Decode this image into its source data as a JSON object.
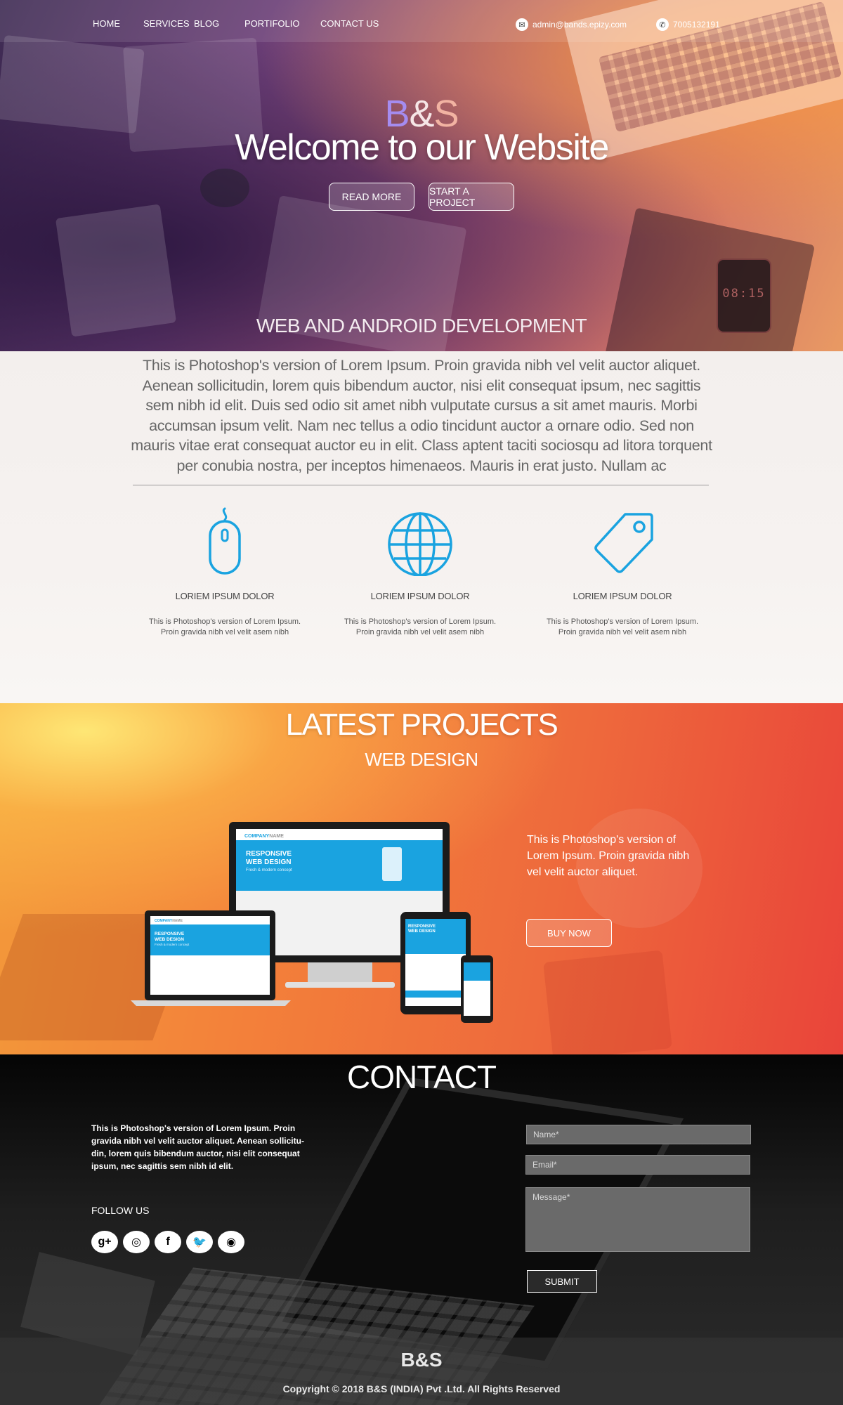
{
  "nav": {
    "items": [
      {
        "label": "HOME"
      },
      {
        "label": "SERVICES"
      },
      {
        "label": "BLOG"
      },
      {
        "label": "PORTIFOLIO"
      },
      {
        "label": "CONTACT US"
      }
    ],
    "email": "admin@bands.epizy.com",
    "phone": "7005132191",
    "email_icon": "envelope-icon",
    "phone_icon": "phone-icon"
  },
  "hero": {
    "logo": {
      "b": "B",
      "amp": "&",
      "s": "S"
    },
    "title": "Welcome to our Website",
    "read_more": "READ MORE",
    "start_project": "START A PROJECT",
    "subtitle": "WEB AND ANDROID DEVELOPMENT",
    "phone_time": "08:15"
  },
  "about": {
    "text": "This is Photoshop's version  of Lorem Ipsum. Proin gravida nibh vel velit auctor aliquet. Aenean sollicitudin, lorem quis bibendum auctor, nisi elit consequat ipsum, nec sagittis sem nibh id elit. Duis sed odio sit amet nibh vulputate cursus a sit amet mauris. Morbi accumsan ipsum velit. Nam nec tellus a odio tincidunt auctor a ornare odio. Sed non mauris vitae erat consequat auctor eu in elit. Class aptent taciti sociosqu ad litora torquent per conubia nostra, per inceptos himenaeos. Mauris in erat justo. Nullam ac"
  },
  "features": [
    {
      "icon": "mouse-icon",
      "title": "LORIEM IPSUM DOLOR",
      "desc": "This is Photoshop's version  of Lorem Ipsum. Proin gravida nibh vel velit asem nibh"
    },
    {
      "icon": "globe-icon",
      "title": "LORIEM IPSUM DOLOR",
      "desc": "This is Photoshop's version  of Lorem Ipsum. Proin gravida nibh vel velit asem nibh"
    },
    {
      "icon": "tag-icon",
      "title": "LORIEM IPSUM DOLOR",
      "desc": "This is Photoshop's version  of Lorem Ipsum. Proin gravida nibh vel velit asem nibh"
    }
  ],
  "projects": {
    "title": "LATEST PROJECTS",
    "subtitle": "WEB DESIGN",
    "text": "This is Photoshop's version  of Lorem Ipsum. Proin gravida nibh vel velit auctor aliquet.",
    "buy_now": "BUY NOW",
    "mockup": {
      "company": "COMPANY",
      "name": "NAME",
      "headline1": "RESPONSIVE",
      "headline2": "WEB DESIGN",
      "tagline": "Fresh & modern concept"
    }
  },
  "contact": {
    "title": "CONTACT",
    "text": "This is Photoshop's version  of Lorem Ipsum. Proin gravida nibh vel velit auctor aliquet. Aenean sollicitu-din, lorem quis bibendum auctor, nisi elit consequat ipsum, nec sagittis sem nibh id elit.",
    "follow": "FOLLOW US",
    "socials": [
      {
        "icon": "google-plus-icon",
        "glyph": "g+"
      },
      {
        "icon": "instagram-icon",
        "glyph": "◎"
      },
      {
        "icon": "facebook-icon",
        "glyph": "f"
      },
      {
        "icon": "twitter-icon",
        "glyph": "🐦"
      },
      {
        "icon": "rss-icon",
        "glyph": "◉"
      }
    ],
    "name_placeholder": "Name*",
    "email_placeholder": "Email*",
    "message_placeholder": "Message*",
    "submit": "SUBMIT"
  },
  "footer": {
    "logo": "B&S",
    "copyright": "Copyright ©  2018 B&S (INDIA) Pvt .Ltd. All Rights Reserved"
  },
  "colors": {
    "accent_blue": "#1aa3e0",
    "hero_purple": "#6d3f78",
    "projects_orange": "#ee6a3c",
    "contact_dark": "#1e1e1e"
  }
}
